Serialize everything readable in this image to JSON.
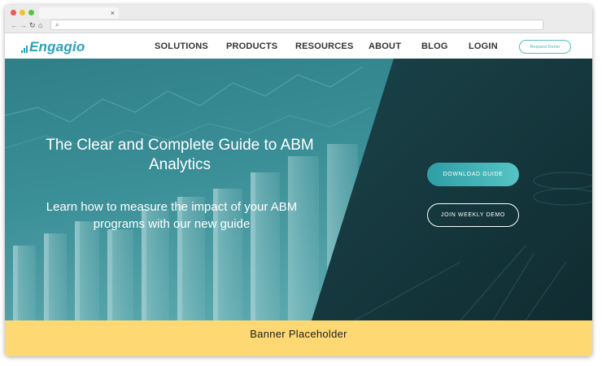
{
  "browser": {
    "tab_close": "×",
    "icons": [
      "back-arrow-icon",
      "forward-arrow-icon",
      "reload-icon",
      "home-icon",
      "search-icon"
    ],
    "back_glyph": "←",
    "forward_glyph": "→",
    "reload_glyph": "↻",
    "home_glyph": "⌂",
    "search_glyph": "⌕"
  },
  "header": {
    "logo_text": "Engagio",
    "nav": [
      "SOLUTIONS",
      "PRODUCTS",
      "RESOURCES",
      "ABOUT",
      "BLOG",
      "LOGIN"
    ],
    "request_demo": "Request Demo"
  },
  "hero": {
    "title": "The Clear and Complete Guide to ABM Analytics",
    "subtitle": "Learn how to measure the impact of your ABM programs with our new guide",
    "download_button": "DOWNLOAD GUIDE",
    "demo_button": "JOIN WEEKLY DEMO"
  },
  "banner": {
    "text": "Banner Placeholder"
  },
  "colors": {
    "brand_teal": "#2ba0b8",
    "hero_teal": "#2a6f78",
    "hero_dark": "#173b40",
    "banner_yellow": "#fed872",
    "button_gradient_start": "#2f9ea5",
    "button_gradient_end": "#56c4c4"
  }
}
